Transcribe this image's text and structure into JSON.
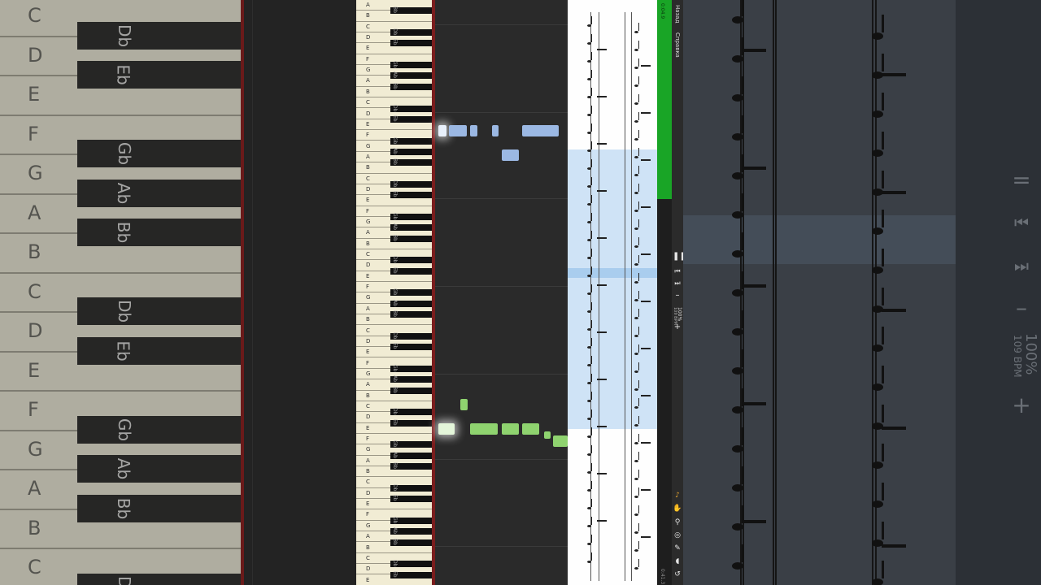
{
  "left_keyboard": {
    "white_labels": [
      "C",
      "D",
      "E",
      "F",
      "G",
      "A",
      "B",
      "C",
      "D",
      "E",
      "F",
      "G",
      "A",
      "B",
      "C"
    ],
    "black_labels": [
      "Db",
      "Eb",
      "Gb",
      "Ab",
      "Bb",
      "Db",
      "Eb",
      "Gb",
      "Ab",
      "Bb",
      "Db"
    ]
  },
  "keyboard": {
    "white_labels": [
      "A",
      "B",
      "C",
      "D",
      "E",
      "F",
      "G",
      "A",
      "B",
      "C",
      "D",
      "E",
      "F",
      "G",
      "A",
      "B",
      "C",
      "D",
      "E",
      "F",
      "G",
      "A",
      "B",
      "C",
      "D",
      "E",
      "F",
      "G",
      "A",
      "B",
      "C",
      "D",
      "E",
      "F",
      "G",
      "A",
      "B",
      "C",
      "D",
      "E",
      "F",
      "G",
      "A",
      "B",
      "C",
      "D",
      "E",
      "F",
      "G",
      "A",
      "B",
      "C",
      "D",
      "E"
    ],
    "black_labels": [
      "Bb",
      "Db",
      "Eb",
      "Gb",
      "Ab",
      "Bb",
      "Db",
      "Eb",
      "Gb",
      "Ab",
      "Bb",
      "Db",
      "Eb",
      "Gb",
      "Ab",
      "Bb",
      "Db",
      "Eb",
      "Gb",
      "Ab",
      "Bb",
      "Db",
      "Eb",
      "Gb",
      "Ab",
      "Bb",
      "Db",
      "Eb",
      "Gb",
      "Ab",
      "Bb",
      "Db",
      "Eb",
      "Gb",
      "Ab",
      "Bb",
      "Db",
      "Eb"
    ]
  },
  "colors": {
    "right_hand": "#9bb8e3",
    "left_hand": "#8fd36f",
    "progress": "#19a526",
    "score_highlight": "#cfe3f6"
  },
  "toolbar": {
    "time_top": "0:04.9",
    "back_label": "Назад",
    "help_label": "Справка",
    "pause_icon": "pause-icon",
    "prev_icon": "skip-back-icon",
    "next_icon": "skip-forward-icon",
    "minus_label": "–",
    "zoom_label": "100%",
    "bpm_label": "109 BPM",
    "plus_label": "+",
    "time_bottom": "0:41.3"
  },
  "tools": [
    "metronome-icon",
    "hand-icon",
    "search-icon",
    "loop-icon",
    "palette-icon",
    "volume-icon",
    "rewind-icon"
  ]
}
